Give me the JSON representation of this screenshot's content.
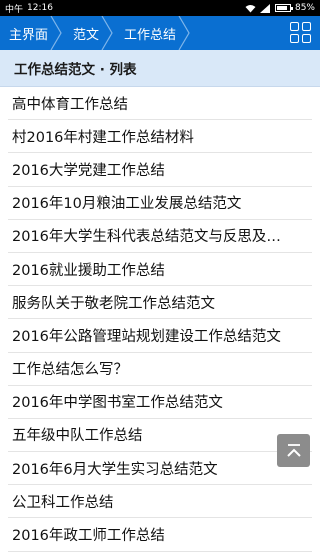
{
  "status_bar": {
    "carrier": "中午",
    "time": "12:16",
    "battery": "85%",
    "battery_level": 0.85
  },
  "header": {
    "breadcrumbs": [
      "主界面",
      "范文",
      "工作总结"
    ],
    "menu_icon": "grid-icon"
  },
  "section": {
    "title": "工作总结范文 · 列表"
  },
  "list": {
    "items": [
      "高中体育工作总结",
      "村2016年村建工作总结材料",
      "2016大学党建工作总结",
      "2016年10月粮油工业发展总结范文",
      "2016年大学生科代表总结范文与反思及…",
      "2016就业援助工作总结",
      "服务队关于敬老院工作总结范文",
      "2016年公路管理站规划建设工作总结范文",
      "工作总结怎么写？",
      "2016年中学图书室工作总结范文",
      "五年级中队工作总结",
      "2016年6月大学生实习总结范文",
      "公卫科工作总结",
      "2016年政工师工作总结"
    ]
  },
  "back_to_top": {
    "icon": "back-to-top-icon"
  },
  "colors": {
    "header_bg": "#0a6fd1",
    "section_bg": "#d9e8f8",
    "top_btn_bg": "#8c8c8c"
  }
}
